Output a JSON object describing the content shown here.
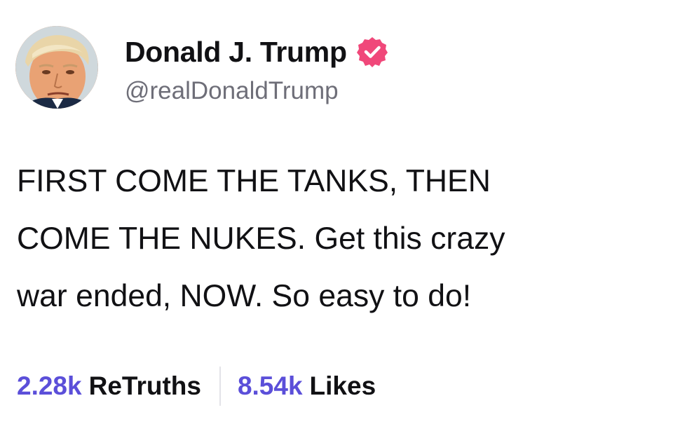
{
  "author": {
    "display_name": "Donald J. Trump",
    "handle": "@realDonaldTrump",
    "verified": true,
    "avatar_icon": "profile-photo",
    "verified_badge_color": "#f0487a"
  },
  "post": {
    "text": "FIRST COME THE TANKS, THEN\nCOME THE NUKES. Get this crazy\nwar ended, NOW. So easy to do!"
  },
  "stats": {
    "retruths_count": "2.28k",
    "retruths_label": "ReTruths",
    "likes_count": "8.54k",
    "likes_label": "Likes",
    "accent_color": "#5b4fd9"
  }
}
